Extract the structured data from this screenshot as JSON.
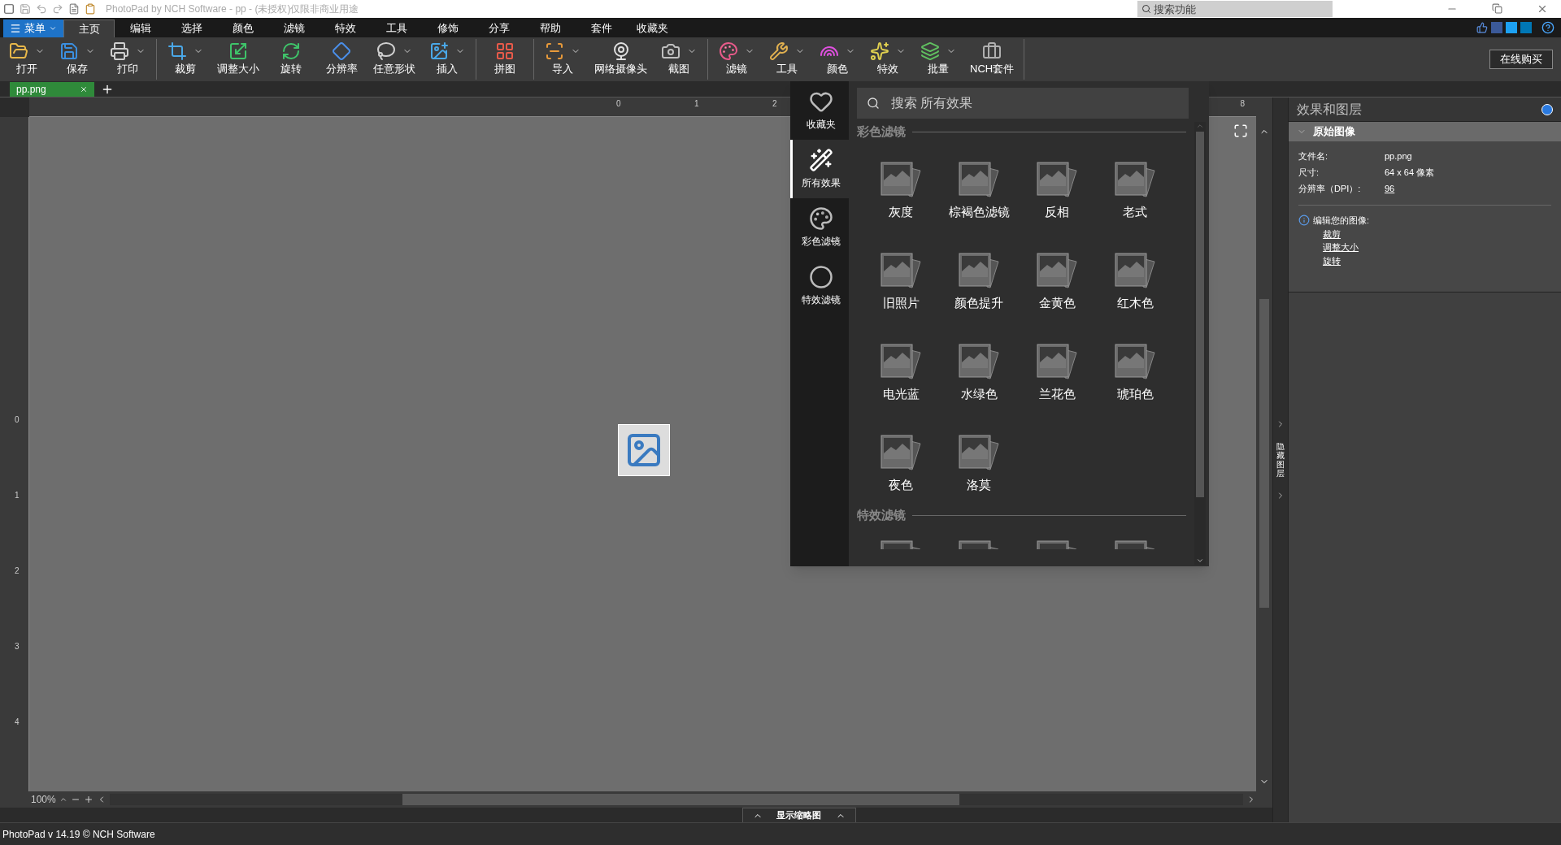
{
  "window": {
    "title": "PhotoPad by NCH Software - pp - (未授权)仅限非商业用途",
    "search": {
      "placeholder": "搜索功能"
    }
  },
  "menu_button": {
    "label": "菜单"
  },
  "menu_tabs": [
    {
      "label": "主页",
      "selected": true
    },
    {
      "label": "编辑",
      "selected": false
    },
    {
      "label": "选择",
      "selected": false
    },
    {
      "label": "颜色",
      "selected": false
    },
    {
      "label": "滤镜",
      "selected": false
    },
    {
      "label": "特效",
      "selected": false
    },
    {
      "label": "工具",
      "selected": false
    },
    {
      "label": "修饰",
      "selected": false
    },
    {
      "label": "分享",
      "selected": false
    },
    {
      "label": "帮助",
      "selected": false
    },
    {
      "label": "套件",
      "selected": false
    },
    {
      "label": "收藏夹",
      "selected": false
    }
  ],
  "toolbar_groups": [
    [
      {
        "label": "打开",
        "dropdown": true
      },
      {
        "label": "保存",
        "dropdown": true
      },
      {
        "label": "打印",
        "dropdown": true
      }
    ],
    [
      {
        "label": "裁剪",
        "dropdown": true
      },
      {
        "label": "调整大小",
        "dropdown": false
      },
      {
        "label": "旋转",
        "dropdown": false
      },
      {
        "label": "分辨率",
        "dropdown": false
      },
      {
        "label": "任意形状",
        "dropdown": true
      },
      {
        "label": "插入",
        "dropdown": true
      }
    ],
    [
      {
        "label": "拼图",
        "dropdown": false
      }
    ],
    [
      {
        "label": "导入",
        "dropdown": true
      },
      {
        "label": "网络摄像头",
        "dropdown": false
      },
      {
        "label": "截图",
        "dropdown": true
      }
    ],
    [
      {
        "label": "滤镜",
        "dropdown": true
      },
      {
        "label": "工具",
        "dropdown": true
      },
      {
        "label": "颜色",
        "dropdown": true
      },
      {
        "label": "特效",
        "dropdown": true
      },
      {
        "label": "批量",
        "dropdown": true
      },
      {
        "label": "NCH套件",
        "dropdown": false
      }
    ]
  ],
  "buy_button": {
    "label": "在线购买"
  },
  "document_tabs": [
    {
      "label": "pp.png",
      "selected": true
    }
  ],
  "top_ruler": {
    "left_labels": [
      "0",
      "1",
      "2"
    ],
    "right_label": "8"
  },
  "left_ruler": {
    "labels": [
      "0",
      "1",
      "2",
      "3",
      "4"
    ]
  },
  "zoom": {
    "value": "100%"
  },
  "thumbnail_toggle": {
    "label": "显示缩略图"
  },
  "hide_layers_tab": {
    "label": "隐藏图层"
  },
  "effects_popup": {
    "categories": [
      {
        "label": "收藏夹",
        "selected": false
      },
      {
        "label": "所有效果",
        "selected": true
      },
      {
        "label": "彩色滤镜",
        "selected": false
      },
      {
        "label": "特效滤镜",
        "selected": false
      }
    ],
    "search": {
      "placeholder": "搜索 所有效果"
    },
    "sections": [
      {
        "title": "彩色滤镜",
        "effects": [
          "灰度",
          "棕褐色滤镜",
          "反相",
          "老式",
          "旧照片",
          "颜色提升",
          "金黄色",
          "红木色",
          "电光蓝",
          "水绿色",
          "兰花色",
          "琥珀色",
          "夜色",
          "洛莫"
        ]
      },
      {
        "title": "特效滤镜"
      }
    ]
  },
  "side_panel": {
    "title": "效果和图层",
    "layer": {
      "title": "原始图像",
      "expanded": true
    },
    "properties": [
      {
        "label": "文件名:",
        "value": "pp.png",
        "link": false
      },
      {
        "label": "尺寸:",
        "value": "64 x 64 像素",
        "link": false
      },
      {
        "label": "分辨率（DPI）:",
        "value": "96",
        "link": true
      }
    ],
    "hint": "编辑您的图像:",
    "links": [
      "裁剪",
      "调整大小",
      "旋转"
    ]
  },
  "status_bar": {
    "text": "PhotoPad v 14.19 © NCH Software"
  }
}
